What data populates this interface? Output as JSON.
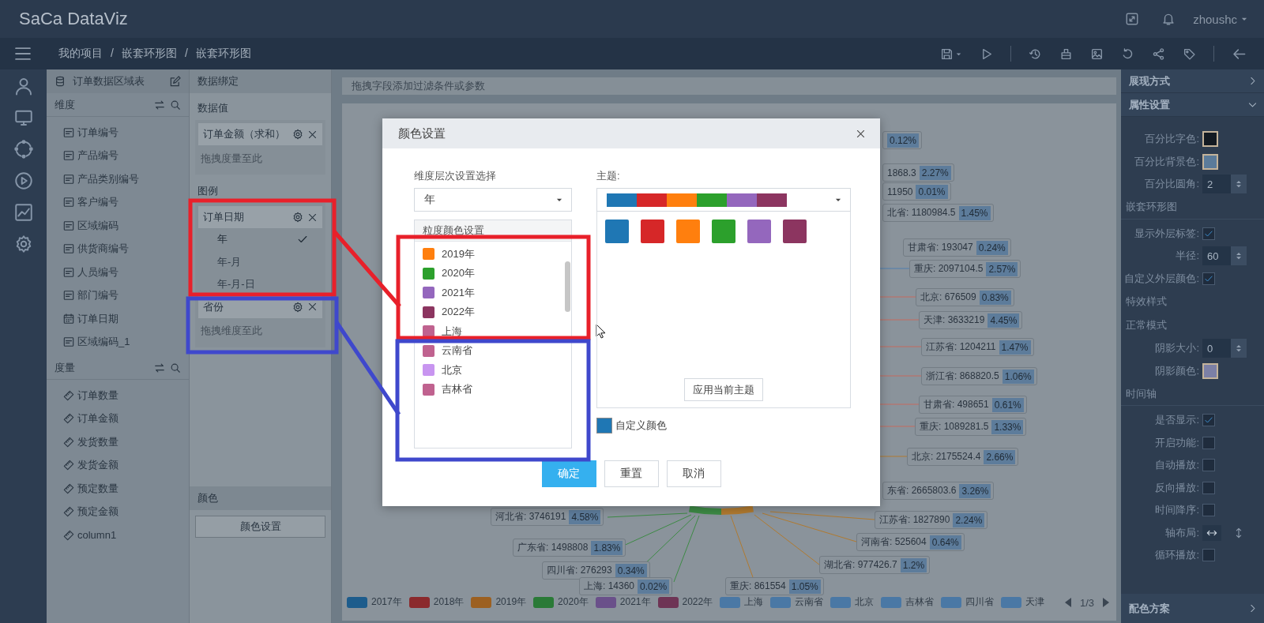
{
  "app": {
    "logo": "SaCa DataViz",
    "user": "zhoushc"
  },
  "breadcrumb": [
    {
      "label": "我的项目"
    },
    {
      "separator": "/",
      "label": "嵌套环形图"
    },
    {
      "separator": "/",
      "label": "嵌套环形图"
    }
  ],
  "fields": {
    "title": "订单数据区域表",
    "dimensions": {
      "title": "维度",
      "items": [
        {
          "label": "订单编号",
          "kind": "text"
        },
        {
          "label": "产品编号",
          "kind": "text"
        },
        {
          "label": "产品类别编号",
          "kind": "text"
        },
        {
          "label": "客户编号",
          "kind": "text"
        },
        {
          "label": "区域编码",
          "kind": "text"
        },
        {
          "label": "供货商编号",
          "kind": "text"
        },
        {
          "label": "人员编号",
          "kind": "text"
        },
        {
          "label": "部门编号",
          "kind": "text"
        },
        {
          "label": "订单日期",
          "kind": "date"
        },
        {
          "label": "区域编码_1",
          "kind": "text"
        }
      ]
    },
    "measures": {
      "title": "度量",
      "items": [
        {
          "label": "订单数量",
          "kind": "measure"
        },
        {
          "label": "订单金额",
          "kind": "measure"
        },
        {
          "label": "发货数量",
          "kind": "measure"
        },
        {
          "label": "发货金额",
          "kind": "measure"
        },
        {
          "label": "预定数量",
          "kind": "measure"
        },
        {
          "label": "预定金额",
          "kind": "measure"
        },
        {
          "label": "column1",
          "kind": "measure"
        }
      ]
    }
  },
  "binding": {
    "title": "数据绑定",
    "values": {
      "title": "数据值",
      "chips": [
        {
          "label": "订单金额（求和）"
        }
      ],
      "placeholder": "拖拽度量至此"
    },
    "legend": {
      "title": "图例",
      "chips": [
        {
          "label": "订单日期",
          "options": [
            {
              "label": "年",
              "selected": true
            },
            {
              "label": "年-月",
              "selected": false
            },
            {
              "label": "年-月-日",
              "selected": false
            }
          ]
        },
        {
          "label": "省份"
        }
      ],
      "placeholder": "拖拽维度至此"
    },
    "color": {
      "title": "颜色",
      "button": "颜色设置"
    }
  },
  "filter_bar": {
    "placeholder": "拖拽字段添加过滤条件或参数"
  },
  "chart_labels": [
    {
      "pct": "0.12%"
    },
    {
      "text": "1868.3",
      "pct": "2.27%"
    },
    {
      "text": "11950",
      "pct": "0.01%"
    },
    {
      "text": "北省: 1180984.5",
      "pct": "1.45%"
    },
    {
      "text": "甘肃省: 193047",
      "pct": "0.24%"
    },
    {
      "text": "重庆: 2097104.5",
      "pct": "2.57%"
    },
    {
      "text": "北京: 676509",
      "pct": "0.83%"
    },
    {
      "text": "天津: 3633219",
      "pct": "4.45%"
    },
    {
      "text": "江苏省: 1204211",
      "pct": "1.47%"
    },
    {
      "text": "浙江省: 868820.5",
      "pct": "1.06%"
    },
    {
      "text": "甘肃省: 498651",
      "pct": "0.61%"
    },
    {
      "text": "重庆: 1089281.5",
      "pct": "1.33%"
    },
    {
      "text": "北京: 2175524.4",
      "pct": "2.66%"
    },
    {
      "text": "东省: 2665803.6",
      "pct": "3.26%"
    },
    {
      "text": "江苏省: 1827890",
      "pct": "2.24%"
    },
    {
      "text": "河南省: 525604",
      "pct": "0.64%"
    },
    {
      "text": "湖北省: 977426.7",
      "pct": "1.2%"
    },
    {
      "text": "河北省: 3746191",
      "pct": "4.58%"
    },
    {
      "text": "广东省: 1498808",
      "pct": "1.83%"
    },
    {
      "text": "四川省: 276293",
      "pct": "0.34%"
    },
    {
      "text": "上海: 14360",
      "pct": "0.02%"
    },
    {
      "text": "重庆: 861554",
      "pct": "1.05%"
    }
  ],
  "legend": {
    "items": [
      {
        "label": "2017年",
        "color": "#1d5c8c"
      },
      {
        "label": "2018年",
        "color": "#8b2a2d"
      },
      {
        "label": "2019年",
        "color": "#9c6021"
      },
      {
        "label": "2020年",
        "color": "#2a7a37"
      },
      {
        "label": "2021年",
        "color": "#6a508a"
      },
      {
        "label": "2022年",
        "color": "#6e3455"
      },
      {
        "label": "上海",
        "color": "#4a78a5"
      },
      {
        "label": "云南省",
        "color": "#4a78a5"
      },
      {
        "label": "北京",
        "color": "#4a78a5"
      },
      {
        "label": "吉林省",
        "color": "#4a78a5"
      },
      {
        "label": "四川省",
        "color": "#4a78a5"
      },
      {
        "label": "天津",
        "color": "#4a78a5"
      }
    ],
    "page": "1/3"
  },
  "properties": {
    "panels": [
      {
        "title": "展现方式",
        "expanded": false
      },
      {
        "title": "属性设置",
        "expanded": true
      }
    ],
    "rows": [
      {
        "kind": "color",
        "label": "百分比字色:",
        "color": "#131a22"
      },
      {
        "kind": "color",
        "label": "百分比背景色:",
        "color": "#5b7b9a"
      },
      {
        "kind": "number",
        "label": "百分比圆角:",
        "value": "2"
      },
      {
        "kind": "section",
        "label": "嵌套环形图"
      },
      {
        "kind": "checkbox",
        "label": "显示外层标签:",
        "checked": true
      },
      {
        "kind": "number",
        "label": "半径:",
        "value": "60"
      },
      {
        "kind": "checkbox",
        "label": "自定义外层颜色:",
        "checked": true
      },
      {
        "kind": "heading",
        "label": "特效样式"
      },
      {
        "kind": "heading",
        "label": "正常模式"
      },
      {
        "kind": "number",
        "label": "阴影大小:",
        "value": "0"
      },
      {
        "kind": "color",
        "label": "阴影颜色:",
        "color": "#7c80a6"
      },
      {
        "kind": "section",
        "label": "时间轴"
      },
      {
        "kind": "checkbox",
        "label": "是否显示:",
        "checked": true
      },
      {
        "kind": "checkbox",
        "label": "开启功能:",
        "checked": false
      },
      {
        "kind": "checkbox",
        "label": "自动播放:",
        "checked": false
      },
      {
        "kind": "checkbox",
        "label": "反向播放:",
        "checked": false
      },
      {
        "kind": "checkbox",
        "label": "时间降序:",
        "checked": false
      },
      {
        "kind": "layout",
        "label": "轴布局:",
        "options": [
          {
            "kind": "horizontal",
            "selected": true
          },
          {
            "kind": "vertical",
            "selected": false
          }
        ]
      },
      {
        "kind": "checkbox",
        "label": "循环播放:",
        "checked": false
      }
    ],
    "footer": {
      "title": "配色方案",
      "expanded": false
    }
  },
  "dialog": {
    "title": "颜色设置",
    "level_label": "维度层次设置选择",
    "level_value": "年",
    "list_title": "粒度颜色设置",
    "entries": [
      {
        "label": "2019年",
        "color": "#ff7f0e"
      },
      {
        "label": "2020年",
        "color": "#2ca02c"
      },
      {
        "label": "2021年",
        "color": "#9467bd"
      },
      {
        "label": "2022年",
        "color": "#8c3560"
      },
      {
        "label": "上海",
        "color": "#c0628f"
      },
      {
        "label": "云南省",
        "color": "#c0628f"
      },
      {
        "label": "北京",
        "color": "#c895f0"
      },
      {
        "label": "吉林省",
        "color": "#c0628f"
      }
    ],
    "theme_label": "主题:",
    "theme": [
      {
        "color": "#1f77b4"
      },
      {
        "color": "#d62728"
      },
      {
        "color": "#ff7f0e"
      },
      {
        "color": "#2ca02c"
      },
      {
        "color": "#9467bd"
      },
      {
        "color": "#8c3560"
      }
    ],
    "palette": [
      {
        "color": "#1f77b4"
      },
      {
        "color": "#d62728"
      },
      {
        "color": "#ff7f0e"
      },
      {
        "color": "#2ca02c"
      },
      {
        "color": "#9467bd"
      },
      {
        "color": "#8c3560"
      }
    ],
    "apply_button": "应用当前主题",
    "custom_color": {
      "label": "自定义颜色",
      "color": "#1f77b4"
    },
    "buttons": [
      {
        "label": "确定",
        "kind": "primary"
      },
      {
        "label": "重置",
        "kind": "default"
      },
      {
        "label": "取消",
        "kind": "default"
      }
    ]
  },
  "annotations": [
    {
      "color": "#e8202a"
    },
    {
      "color": "#3f48cc"
    }
  ]
}
